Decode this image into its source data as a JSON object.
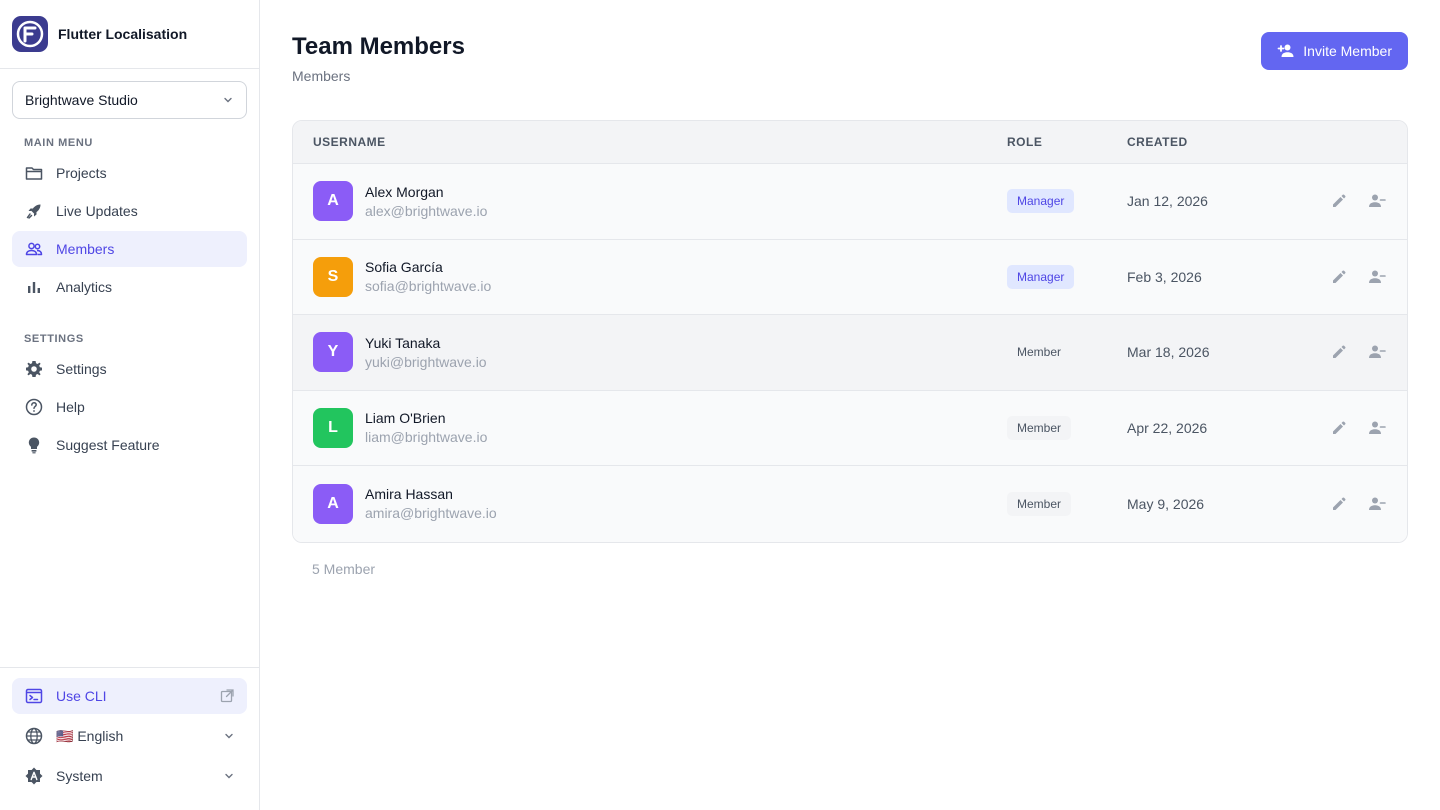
{
  "app": {
    "title": "Flutter Localisation"
  },
  "workspace": {
    "name": "Brightwave Studio"
  },
  "sidebar": {
    "main_menu_label": "MAIN MENU",
    "main_items": [
      {
        "label": "Projects",
        "icon": "folder-icon"
      },
      {
        "label": "Live Updates",
        "icon": "rocket-icon"
      },
      {
        "label": "Members",
        "icon": "people-icon",
        "active": true
      },
      {
        "label": "Analytics",
        "icon": "bar-chart-icon"
      }
    ],
    "settings_label": "SETTINGS",
    "settings_items": [
      {
        "label": "Settings",
        "icon": "gear-icon"
      },
      {
        "label": "Help",
        "icon": "help-icon"
      },
      {
        "label": "Suggest Feature",
        "icon": "lightbulb-icon"
      }
    ],
    "bottom": {
      "cli_label": "Use CLI",
      "language_label": "English",
      "language_flag": "🇺🇸",
      "theme_label": "System"
    }
  },
  "header": {
    "title": "Team Members",
    "subtitle": "Members",
    "invite_label": "Invite Member"
  },
  "table": {
    "columns": {
      "username": "USERNAME",
      "role": "ROLE",
      "created": "CREATED"
    },
    "rows": [
      {
        "initial": "A",
        "name": "Alex Morgan",
        "email": "alex@brightwave.io",
        "role": "Manager",
        "created": "Jan 12, 2026",
        "color": "#8b5cf6"
      },
      {
        "initial": "S",
        "name": "Sofia García",
        "email": "sofia@brightwave.io",
        "role": "Manager",
        "created": "Feb 3, 2026",
        "color": "#f59e0b"
      },
      {
        "initial": "Y",
        "name": "Yuki Tanaka",
        "email": "yuki@brightwave.io",
        "role": "Member",
        "created": "Mar 18, 2026",
        "color": "#8b5cf6"
      },
      {
        "initial": "L",
        "name": "Liam O'Brien",
        "email": "liam@brightwave.io",
        "role": "Member",
        "created": "Apr 22, 2026",
        "color": "#22c55e"
      },
      {
        "initial": "A",
        "name": "Amira Hassan",
        "email": "amira@brightwave.io",
        "role": "Member",
        "created": "May 9, 2026",
        "color": "#8b5cf6"
      }
    ]
  },
  "footer": {
    "count_label": "5 Member"
  },
  "colors": {
    "accent": "#6366f1",
    "accent_bg": "#eef0fd"
  }
}
